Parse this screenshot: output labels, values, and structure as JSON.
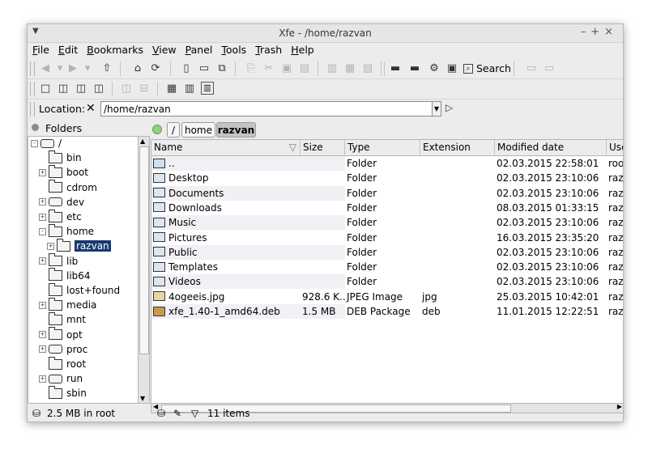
{
  "window": {
    "title": "Xfe - /home/razvan"
  },
  "menu": [
    "File",
    "Edit",
    "Bookmarks",
    "View",
    "Panel",
    "Tools",
    "Trash",
    "Help"
  ],
  "toolbar": {
    "search_label": "Search"
  },
  "location": {
    "label": "Location:",
    "value": "/home/razvan"
  },
  "folders_panel": {
    "title": "Folders",
    "tree": [
      {
        "label": "/",
        "indent": 0,
        "expander": "-",
        "icon": "drive-icon"
      },
      {
        "label": "bin",
        "indent": 1,
        "expander": "",
        "icon": "folder-icon"
      },
      {
        "label": "boot",
        "indent": 1,
        "expander": "+",
        "icon": "folder-icon"
      },
      {
        "label": "cdrom",
        "indent": 1,
        "expander": "",
        "icon": "folder-icon"
      },
      {
        "label": "dev",
        "indent": 1,
        "expander": "+",
        "icon": "drive-icon"
      },
      {
        "label": "etc",
        "indent": 1,
        "expander": "+",
        "icon": "folder-icon"
      },
      {
        "label": "home",
        "indent": 1,
        "expander": "-",
        "icon": "folder-icon"
      },
      {
        "label": "razvan",
        "indent": 2,
        "expander": "+",
        "icon": "folder-open-icon",
        "selected": true
      },
      {
        "label": "lib",
        "indent": 1,
        "expander": "+",
        "icon": "folder-icon"
      },
      {
        "label": "lib64",
        "indent": 1,
        "expander": "",
        "icon": "folder-icon"
      },
      {
        "label": "lost+found",
        "indent": 1,
        "expander": "",
        "icon": "locked-folder-icon"
      },
      {
        "label": "media",
        "indent": 1,
        "expander": "+",
        "icon": "folder-icon"
      },
      {
        "label": "mnt",
        "indent": 1,
        "expander": "",
        "icon": "folder-icon"
      },
      {
        "label": "opt",
        "indent": 1,
        "expander": "+",
        "icon": "folder-icon"
      },
      {
        "label": "proc",
        "indent": 1,
        "expander": "+",
        "icon": "drive-icon"
      },
      {
        "label": "root",
        "indent": 1,
        "expander": "",
        "icon": "locked-folder-icon"
      },
      {
        "label": "run",
        "indent": 1,
        "expander": "+",
        "icon": "drive-icon"
      },
      {
        "label": "sbin",
        "indent": 1,
        "expander": "",
        "icon": "folder-icon"
      }
    ]
  },
  "breadcrumbs": [
    "/",
    "home",
    "razvan"
  ],
  "file_list": {
    "columns": [
      "Name",
      "Size",
      "Type",
      "Extension",
      "Modified date",
      "User"
    ],
    "rows": [
      {
        "name": "..",
        "size": "",
        "type": "Folder",
        "ext": "",
        "modified": "02.03.2015 22:58:01",
        "user": "root",
        "icon": "parent-folder-icon"
      },
      {
        "name": "Desktop",
        "size": "",
        "type": "Folder",
        "ext": "",
        "modified": "02.03.2015 23:10:06",
        "user": "razvan",
        "icon": "folder-icon"
      },
      {
        "name": "Documents",
        "size": "",
        "type": "Folder",
        "ext": "",
        "modified": "02.03.2015 23:10:06",
        "user": "razvan",
        "icon": "folder-icon"
      },
      {
        "name": "Downloads",
        "size": "",
        "type": "Folder",
        "ext": "",
        "modified": "08.03.2015 01:33:15",
        "user": "razvan",
        "icon": "folder-icon"
      },
      {
        "name": "Music",
        "size": "",
        "type": "Folder",
        "ext": "",
        "modified": "02.03.2015 23:10:06",
        "user": "razvan",
        "icon": "folder-icon"
      },
      {
        "name": "Pictures",
        "size": "",
        "type": "Folder",
        "ext": "",
        "modified": "16.03.2015 23:35:20",
        "user": "razvan",
        "icon": "folder-icon"
      },
      {
        "name": "Public",
        "size": "",
        "type": "Folder",
        "ext": "",
        "modified": "02.03.2015 23:10:06",
        "user": "razvan",
        "icon": "folder-icon"
      },
      {
        "name": "Templates",
        "size": "",
        "type": "Folder",
        "ext": "",
        "modified": "02.03.2015 23:10:06",
        "user": "razvan",
        "icon": "folder-icon"
      },
      {
        "name": "Videos",
        "size": "",
        "type": "Folder",
        "ext": "",
        "modified": "02.03.2015 23:10:06",
        "user": "razvan",
        "icon": "folder-icon"
      },
      {
        "name": "4ogeeis.jpg",
        "size": "928.6 K...",
        "type": "JPEG Image",
        "ext": "jpg",
        "modified": "25.03.2015 10:42:01",
        "user": "razvan",
        "icon": "image-file-icon"
      },
      {
        "name": "xfe_1.40-1_amd64.deb",
        "size": "1.5 MB",
        "type": "DEB Package",
        "ext": "deb",
        "modified": "11.01.2015 12:22:51",
        "user": "razvan",
        "icon": "package-file-icon"
      }
    ]
  },
  "status": {
    "left": "2.5 MB in root",
    "right": "11 items"
  }
}
